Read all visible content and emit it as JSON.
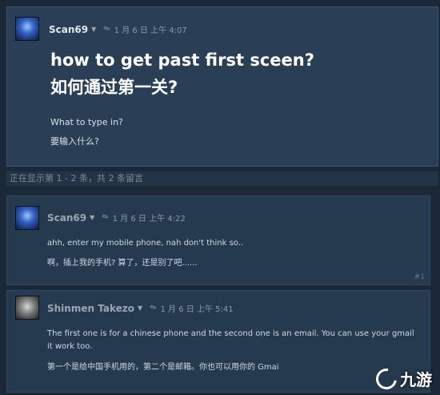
{
  "topic": {
    "author": "Scan69",
    "timestamp": "1 月 6 日 上午 4:07",
    "title": "how to get past first sceen?",
    "title_cn": "如何通过第一关?",
    "body_line1": "What to type in?",
    "body_line2": "要输入什么?"
  },
  "comment_count": "正在显示第 1 - 2 条，共 2 条留言",
  "replies": [
    {
      "author": "Scan69",
      "timestamp": "1 月 6 日 上午 4:22",
      "line1": "ahh, enter my mobile phone, nah don't think so..",
      "line2": "啊，插上我的手机? 算了，还是别了吧......",
      "number": "#1"
    },
    {
      "author": "Shinmen Takezo",
      "timestamp": "1 月 6 日 上午 5:41",
      "line1": "The first one is for a chinese phone and the second one is an email. You can use your gmail",
      "line2": "it work too.",
      "line3": "第一个是给中国手机用的，第二个是邮箱。你也可以用你的 Gmai"
    }
  ],
  "watermark": "九游",
  "icons": {
    "caret": "dropdown-caret-icon",
    "pin": "pin-icon",
    "logo": "jiuyou-logo-icon"
  },
  "colors": {
    "background": "#1b2838",
    "topic_panel": "#2a3f56",
    "reply_panel": "#263a4f",
    "text_primary": "#ffffff",
    "text_muted": "#8f98a0"
  }
}
